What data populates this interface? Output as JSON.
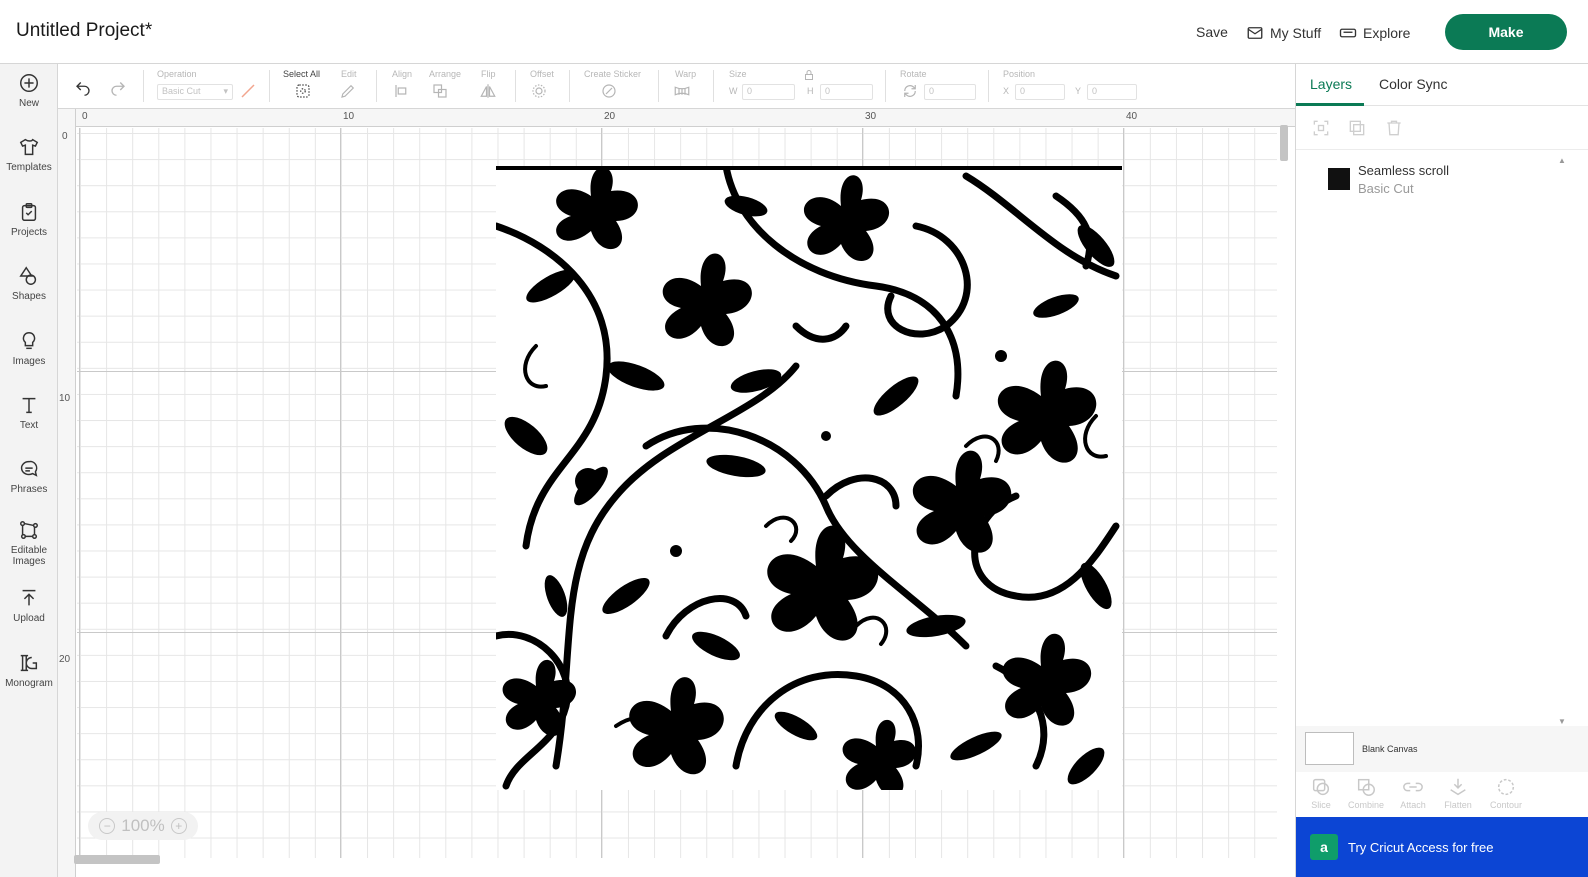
{
  "header": {
    "project_title": "Untitled Project*",
    "save_label": "Save",
    "mystuff_label": "My Stuff",
    "explore_label": "Explore",
    "make_label": "Make",
    "make_color": "#0b7a55"
  },
  "sidebar": {
    "items": [
      {
        "label": "New",
        "icon": "plus-circle-icon"
      },
      {
        "label": "Templates",
        "icon": "shirt-icon"
      },
      {
        "label": "Projects",
        "icon": "clipboard-icon"
      },
      {
        "label": "Shapes",
        "icon": "shapes-icon"
      },
      {
        "label": "Images",
        "icon": "lightbulb-icon"
      },
      {
        "label": "Text",
        "icon": "text-icon"
      },
      {
        "label": "Phrases",
        "icon": "speech-bubble-icon"
      },
      {
        "label": "Editable Images",
        "line1": "Editable",
        "line2": "Images",
        "icon": "editable-images-icon"
      },
      {
        "label": "Upload",
        "icon": "upload-icon"
      },
      {
        "label": "Monogram",
        "icon": "monogram-icon"
      }
    ]
  },
  "toolbar": {
    "operation_label": "Operation",
    "operation_value": "Basic Cut",
    "select_all_label": "Select All",
    "edit_label": "Edit",
    "align_label": "Align",
    "arrange_label": "Arrange",
    "flip_label": "Flip",
    "offset_label": "Offset",
    "create_sticker_label": "Create Sticker",
    "warp_label": "Warp",
    "size_label": "Size",
    "w_label": "W",
    "w_value": "0",
    "h_label": "H",
    "h_value": "0",
    "rotate_label": "Rotate",
    "rotate_value": "0",
    "position_label": "Position",
    "x_label": "X",
    "x_value": "0",
    "y_label": "Y",
    "y_value": "0"
  },
  "ruler": {
    "top": [
      "0",
      "10",
      "20",
      "30",
      "40"
    ],
    "left": [
      "0",
      "10",
      "20"
    ]
  },
  "canvas": {
    "zoom": "100%",
    "design_name": "Seamless scroll floral pattern"
  },
  "right_panel": {
    "tabs": [
      "Layers",
      "Color Sync"
    ],
    "active_tab": "Layers",
    "layer": {
      "name": "Seamless scroll",
      "operation": "Basic Cut"
    },
    "canvas_label": "Blank Canvas",
    "bottom_tools": [
      "Slice",
      "Combine",
      "Attach",
      "Flatten",
      "Contour"
    ],
    "promo": "Try Cricut Access for free",
    "promo_logo": "a",
    "promo_color": "#0c45d4"
  }
}
